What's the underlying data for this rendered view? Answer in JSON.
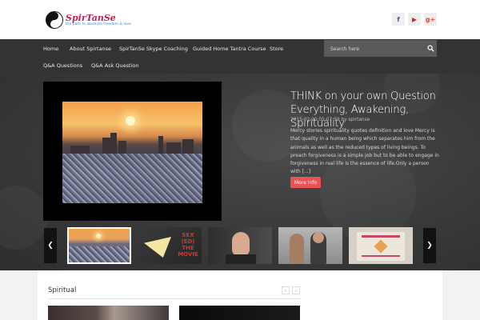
{
  "header": {
    "logo_name": "SpirTanSe",
    "logo_tagline": "the path to absolute freedom & love",
    "social": [
      {
        "icon": "facebook-icon",
        "glyph": "f"
      },
      {
        "icon": "youtube-icon",
        "glyph": "▶"
      },
      {
        "icon": "google-plus-icon",
        "glyph": "g+"
      }
    ]
  },
  "nav": {
    "items": [
      "Home",
      "About Spirtanse",
      "SpirTanSe Skype Coaching",
      "Guided Home Tantra Course",
      "Store",
      "Q&A Questions",
      "Q&A Ask Question"
    ],
    "search_placeholder": "Search here"
  },
  "slider": {
    "title": "THINK on your own Question Everything, Awakening, Spirituality",
    "date": "2015-02-20 05:07:59",
    "by_label": "by",
    "author": "spirtanse",
    "excerpt": "Mercy stories spirituality quotes definition and love Mercy is that quality in a human being which separates him from the animals as well as the reduced types of living beings. To preach forgiveness is a simple job but to be able to engage in forgiveness in real life is the essence of life.Only a person with [...]",
    "more_label": "More Info",
    "thumb2_text": "SEX (ED) THE MOVIE"
  },
  "spiritual": {
    "title": "Spiritual"
  },
  "colors": {
    "accent": "#e95353",
    "nav_bg": "#333333",
    "brand": "#c2205a"
  }
}
